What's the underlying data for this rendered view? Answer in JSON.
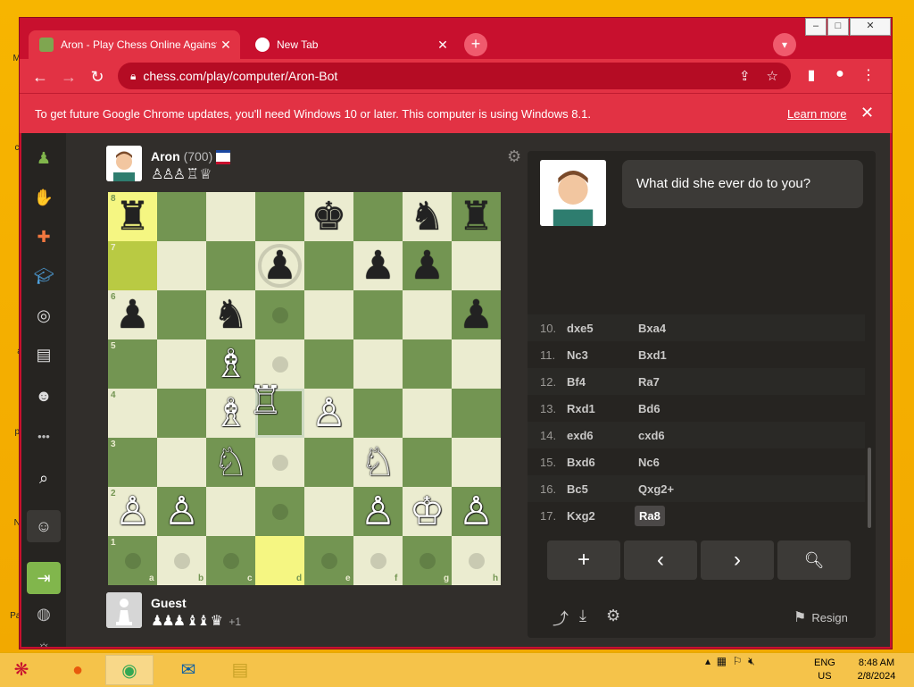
{
  "browser": {
    "tabs": [
      {
        "title": "Aron - Play Chess Online Against",
        "active": true
      },
      {
        "title": "New Tab",
        "active": false
      }
    ],
    "url": "chess.com/play/computer/Aron-Bot",
    "infobar": {
      "message": "To get future Google Chrome updates, you'll need Windows 10 or later. This computer is using Windows 8.1.",
      "learn_more": "Learn more"
    }
  },
  "sidenav": [
    "pawn-logo-icon",
    "play-icon",
    "puzzles-icon",
    "learn-icon",
    "watch-icon",
    "news-icon",
    "social-icon",
    "more-icon",
    "search-icon",
    "add-friend-icon",
    "login-icon",
    "globe-icon",
    "brightness-icon"
  ],
  "top_player": {
    "name": "Aron",
    "rating": "(700)",
    "captures": "♙♙♙ ♖ ♕"
  },
  "bottom_player": {
    "name": "Guest",
    "captures": "♟♟♟ ♝♝ ♛",
    "advantage": "+1"
  },
  "coach_message": "What did she ever do to you?",
  "moves": [
    {
      "no": "10.",
      "white": "dxe5",
      "black": "Bxa4"
    },
    {
      "no": "11.",
      "white": "Nc3",
      "black": "Bxd1"
    },
    {
      "no": "12.",
      "white": "Bf4",
      "black": "Ra7"
    },
    {
      "no": "13.",
      "white": "Rxd1",
      "black": "Bd6"
    },
    {
      "no": "14.",
      "white": "exd6",
      "black": "cxd6"
    },
    {
      "no": "15.",
      "white": "Bxd6",
      "black": "Nc6"
    },
    {
      "no": "16.",
      "white": "Bc5",
      "black": "Qxg2+"
    },
    {
      "no": "17.",
      "white": "Kxg2",
      "black": "Ra8"
    }
  ],
  "controls": {
    "resign": "Resign"
  },
  "board": {
    "files": [
      "a",
      "b",
      "c",
      "d",
      "e",
      "f",
      "g",
      "h"
    ],
    "ranks": [
      "8",
      "7",
      "6",
      "5",
      "4",
      "3",
      "2",
      "1"
    ],
    "pieces": [
      {
        "sq": "a8",
        "p": "♜",
        "c": "b"
      },
      {
        "sq": "e8",
        "p": "♚",
        "c": "b"
      },
      {
        "sq": "g8",
        "p": "♞",
        "c": "b"
      },
      {
        "sq": "h8",
        "p": "♜",
        "c": "b"
      },
      {
        "sq": "d7",
        "p": "♟",
        "c": "b"
      },
      {
        "sq": "f7",
        "p": "♟",
        "c": "b"
      },
      {
        "sq": "g7",
        "p": "♟",
        "c": "b"
      },
      {
        "sq": "a6",
        "p": "♟",
        "c": "b"
      },
      {
        "sq": "c6",
        "p": "♞",
        "c": "b"
      },
      {
        "sq": "h6",
        "p": "♟",
        "c": "b"
      },
      {
        "sq": "c5",
        "p": "♗",
        "c": "w"
      },
      {
        "sq": "c4",
        "p": "♗",
        "c": "w"
      },
      {
        "sq": "d4",
        "p": "♖",
        "c": "w"
      },
      {
        "sq": "e4",
        "p": "♙",
        "c": "w"
      },
      {
        "sq": "c3",
        "p": "♘",
        "c": "w"
      },
      {
        "sq": "f3",
        "p": "♘",
        "c": "w"
      },
      {
        "sq": "a2",
        "p": "♙",
        "c": "w"
      },
      {
        "sq": "b2",
        "p": "♙",
        "c": "w"
      },
      {
        "sq": "f2",
        "p": "♙",
        "c": "w"
      },
      {
        "sq": "g2",
        "p": "♔",
        "c": "w"
      },
      {
        "sq": "h2",
        "p": "♙",
        "c": "w"
      }
    ],
    "highlights": [
      "a8",
      "a7",
      "d1"
    ],
    "hover": "d4",
    "ring": [
      "d7"
    ],
    "dots": [
      "d6",
      "d5",
      "d3",
      "d2",
      "a1",
      "b1",
      "c1",
      "e1",
      "f1",
      "g1",
      "h1"
    ]
  },
  "taskbar": {
    "lang": "ENG",
    "region": "US",
    "time": "8:48 AM",
    "date": "2/8/2024"
  },
  "colors": {
    "chrome_red": "#c8102e",
    "board_light": "#ebecd0",
    "board_dark": "#739552"
  }
}
